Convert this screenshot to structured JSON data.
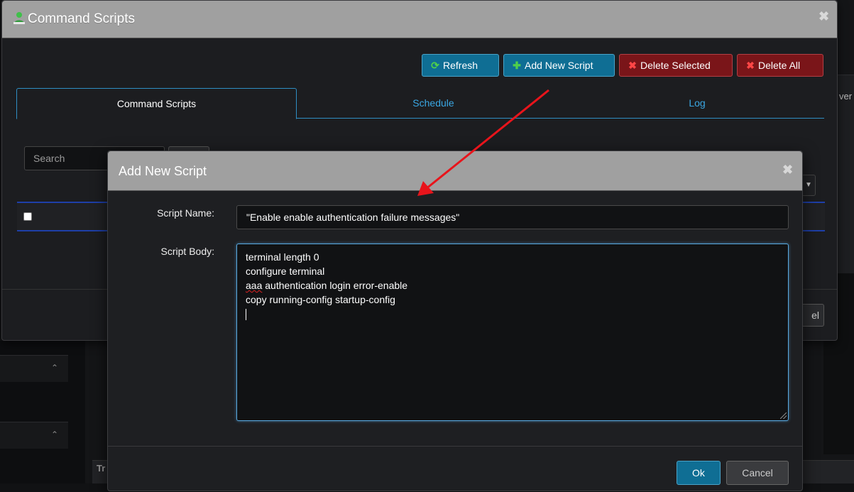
{
  "outer_dialog": {
    "title": "Command Scripts",
    "title_icon": "user-icon",
    "toolbar": {
      "refresh_label": "Refresh",
      "add_label": "Add New Script",
      "delete_selected_label": "Delete Selected",
      "delete_all_label": "Delete All"
    },
    "tabs": [
      {
        "label": "Command Scripts",
        "active": true
      },
      {
        "label": "Schedule",
        "active": false
      },
      {
        "label": "Log",
        "active": false
      }
    ],
    "search": {
      "placeholder": "Search",
      "value": ""
    },
    "footer_button_partial": "el"
  },
  "background": {
    "right_peek_text": "ver",
    "bottom_bar_text": "Tr"
  },
  "modal": {
    "title": "Add New Script",
    "script_name_label": "Script Name:",
    "script_name_value": "\"Enable enable authentication failure messages\"",
    "script_body_label": "Script Body:",
    "script_body_lines": [
      "terminal length 0",
      "configure terminal",
      "aaa authentication login error-enable",
      "copy running-config startup-config"
    ],
    "ok_label": "Ok",
    "cancel_label": "Cancel"
  },
  "colors": {
    "accent": "#0f6e94",
    "danger": "#7a1519",
    "tab_active_border": "#2f8fc4",
    "annotation_arrow": "#e8141b"
  }
}
